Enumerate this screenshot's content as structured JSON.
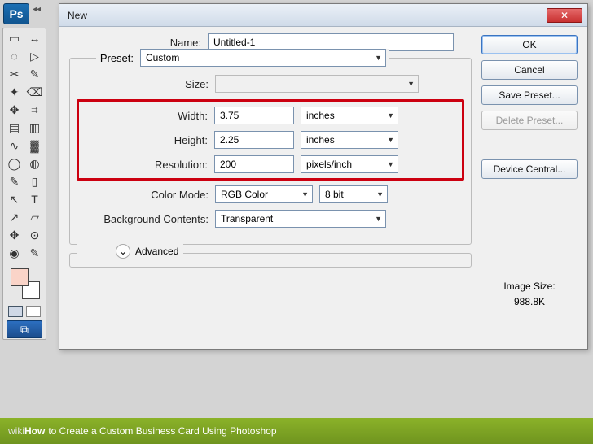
{
  "app": {
    "logo": "Ps",
    "tools": [
      [
        "▭",
        "↔"
      ],
      [
        "◌",
        "▷"
      ],
      [
        "✂",
        "✎"
      ],
      [
        "✦",
        "⌫"
      ],
      [
        "✥",
        "⌗"
      ],
      [
        "▤",
        "▥"
      ],
      [
        "∿",
        "▓"
      ],
      [
        "◯",
        "◍"
      ],
      [
        "✎",
        "▯"
      ],
      [
        "↖",
        "T"
      ],
      [
        "↗",
        "▱"
      ],
      [
        "✥",
        "⊙"
      ],
      [
        "◉",
        "✎"
      ]
    ],
    "screen_toggle_glyph": "⧉"
  },
  "dialog": {
    "title": "New",
    "labels": {
      "name": "Name:",
      "preset": "Preset:",
      "size": "Size:",
      "width": "Width:",
      "height": "Height:",
      "resolution": "Resolution:",
      "color_mode": "Color Mode:",
      "bg_contents": "Background Contents:",
      "advanced": "Advanced",
      "image_size_label": "Image Size:"
    },
    "values": {
      "name": "Untitled-1",
      "preset": "Custom",
      "size": "",
      "width": "3.75",
      "width_unit": "inches",
      "height": "2.25",
      "height_unit": "inches",
      "resolution": "200",
      "resolution_unit": "pixels/inch",
      "color_mode": "RGB Color",
      "bit_depth": "8 bit",
      "bg_contents": "Transparent",
      "image_size": "988.8K"
    },
    "buttons": {
      "ok": "OK",
      "cancel": "Cancel",
      "save_preset": "Save Preset...",
      "delete_preset": "Delete Preset...",
      "device_central": "Device Central..."
    }
  },
  "caption": {
    "prefix": "wiki",
    "how": "How",
    "rest": "to Create a Custom Business Card Using Photoshop"
  }
}
